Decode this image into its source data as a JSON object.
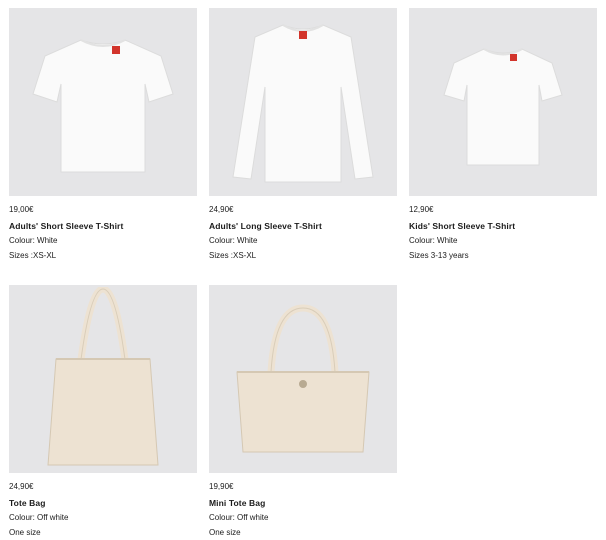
{
  "products": [
    {
      "price": "19,00€",
      "name": "Adults' Short Sleeve T-Shirt",
      "colour": "Colour: White",
      "sizes": "Sizes :XS-XL",
      "image_icon": "tshirt-short-sleeve",
      "bg_color": "#e5e5e7"
    },
    {
      "price": "24,90€",
      "name": "Adults' Long Sleeve T-Shirt",
      "colour": "Colour: White",
      "sizes": "Sizes :XS-XL",
      "image_icon": "tshirt-long-sleeve",
      "bg_color": "#e5e5e7"
    },
    {
      "price": "12,90€",
      "name": "Kids' Short Sleeve T-Shirt",
      "colour": "Colour: White",
      "sizes": "Sizes 3-13 years",
      "image_icon": "tshirt-kids",
      "bg_color": "#e5e5e7"
    },
    {
      "price": "24,90€",
      "name": "Tote Bag",
      "colour": "Colour: Off white",
      "sizes": "One size",
      "image_icon": "tote-bag",
      "bg_color": "#e5e5e7"
    },
    {
      "price": "19,90€",
      "name": "Mini Tote Bag",
      "colour": "Colour: Off white",
      "sizes": "One size",
      "image_icon": "mini-tote-bag",
      "bg_color": "#e5e5e7"
    }
  ]
}
